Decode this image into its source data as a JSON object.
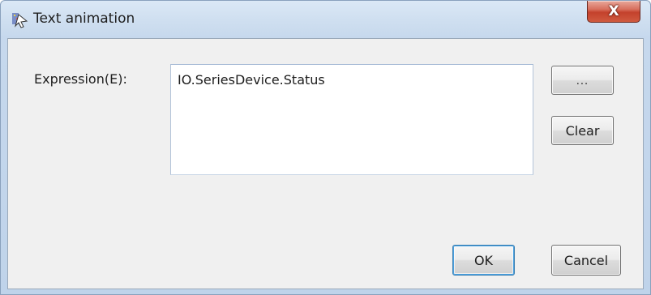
{
  "window": {
    "title": "Text animation",
    "close_label": "X"
  },
  "form": {
    "expression_label": "Expression(E):",
    "expression_value": "IO.SeriesDevice.Status"
  },
  "buttons": {
    "browse_label": "...",
    "clear_label": "Clear",
    "ok_label": "OK",
    "cancel_label": "Cancel"
  },
  "icons": {
    "app": "text-animation-app-icon",
    "close": "close-icon"
  },
  "colors": {
    "titlebar": "#cfdff0",
    "close_button": "#c4412c",
    "client_bg": "#f0f0f0",
    "ok_focus_border": "#3c7fb1"
  }
}
